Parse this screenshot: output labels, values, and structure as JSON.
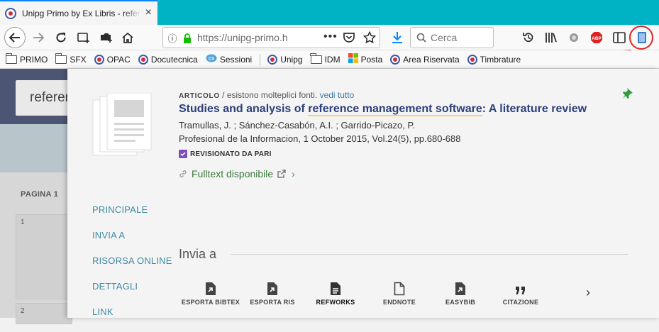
{
  "browser": {
    "tab_title": "Unipg Primo by Ex Libris - refer",
    "tab_close": "×",
    "url": "https://unipg-primo.h",
    "url_more": "•••",
    "search_placeholder": "Cerca",
    "bookmarks": [
      {
        "label": "PRIMO",
        "icon": "folder-icon"
      },
      {
        "label": "SFX",
        "icon": "folder-icon"
      },
      {
        "label": "OPAC",
        "icon": "unipg-logo-icon"
      },
      {
        "label": "Docutecnica",
        "icon": "unipg-logo-icon"
      },
      {
        "label": "Sessioni",
        "icon": "cisco-icon"
      },
      {
        "label": "Unipg",
        "icon": "unipg-logo-icon"
      },
      {
        "label": "IDM",
        "icon": "folder-icon"
      },
      {
        "label": "Posta",
        "icon": "windows-icon"
      },
      {
        "label": "Area Riservata",
        "icon": "unipg-logo-icon"
      },
      {
        "label": "Timbrature",
        "icon": "unipg-logo-icon"
      }
    ]
  },
  "background": {
    "search_text": "referen",
    "page_label": "PAGINA 1",
    "result_numbers": [
      "1",
      "2"
    ]
  },
  "record": {
    "type": "ARTICOLO",
    "type_suffix": " / esistono molteplici fonti. ",
    "see_all": "vedi tutto",
    "title_before": "Studies and analysis of ",
    "title_highlight": "reference management software",
    "title_after": ": A literature review",
    "authors": "Tramullas, J. ; Sánchez-Casabón, A.I. ; Garrido-Picazo, P.",
    "source": "Profesional de la Informacion, 1 October 2015, Vol.24(5), pp.680-688",
    "peer_reviewed": "REVISIONATO DA PARI",
    "fulltext": "Fulltext disponibile"
  },
  "sidenav": [
    "PRINCIPALE",
    "INVIA A",
    "RISORSA ONLINE",
    "DETTAGLI",
    "LINK"
  ],
  "send_to": {
    "heading": "Invia a",
    "actions": [
      {
        "label": "ESPORTA BIBTEX",
        "icon": "export-file-icon"
      },
      {
        "label": "ESPORTA RIS",
        "icon": "export-file-icon"
      },
      {
        "label": "REFWORKS",
        "icon": "document-icon"
      },
      {
        "label": "ENDNOTE",
        "icon": "file-icon"
      },
      {
        "label": "EASYBIB",
        "icon": "export-file-icon"
      },
      {
        "label": "CITAZIONE",
        "icon": "quote-icon"
      }
    ],
    "next": "›"
  },
  "colors": {
    "tabstrip": "#00b3c4",
    "title": "#2c3f7a",
    "link": "#3f8ba1",
    "fulltext": "#3c7a3c",
    "highlight": "#f3d55b",
    "annotation": "#e02424"
  }
}
